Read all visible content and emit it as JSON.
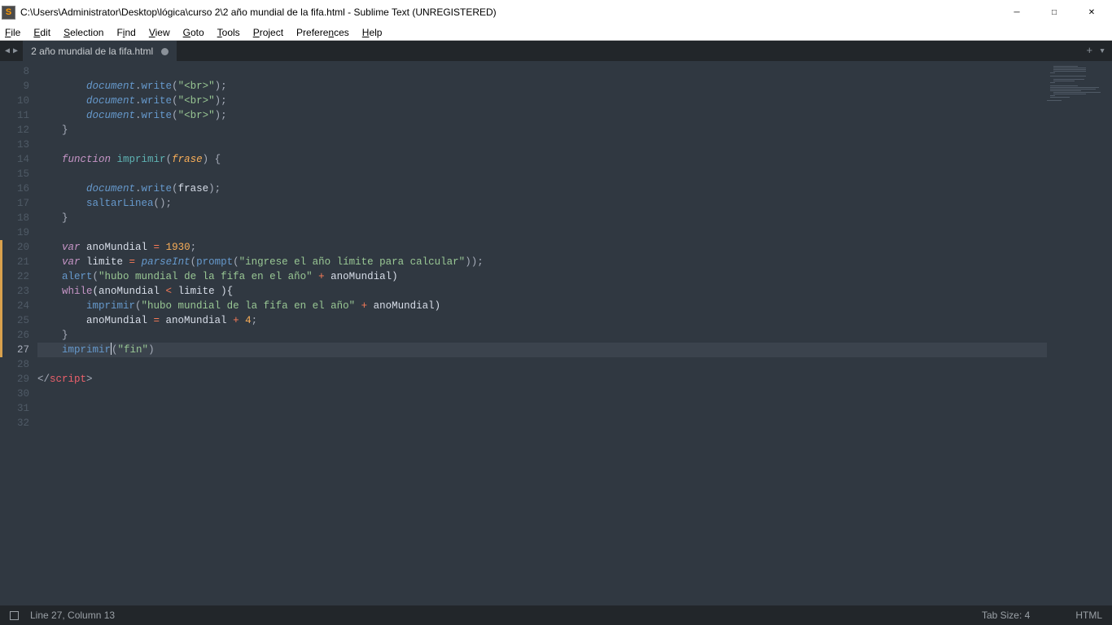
{
  "window": {
    "title": "C:\\Users\\Administrator\\Desktop\\lógica\\curso 2\\2 año mundial de la fifa.html - Sublime Text (UNREGISTERED)"
  },
  "menu": {
    "file": "File",
    "edit": "Edit",
    "selection": "Selection",
    "find": "Find",
    "view": "View",
    "goto": "Goto",
    "tools": "Tools",
    "project": "Project",
    "preferences": "Preferences",
    "help": "Help"
  },
  "tab": {
    "name": "2 año mundial de la fifa.html"
  },
  "gutter": {
    "start": 8,
    "end": 32,
    "active": 27,
    "modified": [
      20,
      21,
      22,
      23,
      24,
      25,
      26,
      27
    ]
  },
  "code": {
    "l8": "",
    "l9a": "document",
    "l9b": ".",
    "l9c": "write",
    "l9d": "(",
    "l9e": "\"<br>\"",
    "l9f": ");",
    "l10a": "document",
    "l10b": ".",
    "l10c": "write",
    "l10d": "(",
    "l10e": "\"<br>\"",
    "l10f": ");",
    "l11a": "document",
    "l11b": ".",
    "l11c": "write",
    "l11d": "(",
    "l11e": "\"<br>\"",
    "l11f": ");",
    "l12": "}",
    "l14a": "function",
    "l14b": " ",
    "l14c": "imprimir",
    "l14d": "(",
    "l14e": "frase",
    "l14f": ")",
    "l14g": " {",
    "l16a": "document",
    "l16b": ".",
    "l16c": "write",
    "l16d": "(",
    "l16e": "frase",
    "l16f": ");",
    "l17a": "saltarLinea",
    "l17b": "();",
    "l18": "}",
    "l20a": "var",
    "l20b": " anoMundial ",
    "l20c": "=",
    "l20d": " ",
    "l20e": "1930",
    "l20f": ";",
    "l21a": "var",
    "l21b": " limite ",
    "l21c": "=",
    "l21d": " ",
    "l21e": "parseInt",
    "l21f": "(",
    "l21g": "prompt",
    "l21h": "(",
    "l21i": "\"ingrese el año límite para calcular\"",
    "l21j": "));",
    "l22a": "alert",
    "l22b": "(",
    "l22c": "\"hubo mundial de la fifa en el año\"",
    "l22d": " ",
    "l22e": "+",
    "l22f": " anoMundial)",
    "l23a": "while",
    "l23b": "(anoMundial ",
    "l23c": "<",
    "l23d": " limite ){",
    "l24a": "imprimir",
    "l24b": "(",
    "l24c": "\"hubo mundial de la fifa en el año\"",
    "l24d": " ",
    "l24e": "+",
    "l24f": " anoMundial)",
    "l25a": "anoMundial ",
    "l25b": "=",
    "l25c": " anoMundial ",
    "l25d": "+",
    "l25e": " ",
    "l25f": "4",
    "l25g": ";",
    "l26": "}",
    "l27a": "imprimir",
    "l27b": "(",
    "l27c": "\"fin\"",
    "l27d": ")",
    "l29a": "</",
    "l29b": "script",
    "l29c": ">"
  },
  "status": {
    "pos": "Line 27, Column 13",
    "tabsize": "Tab Size: 4",
    "lang": "HTML"
  }
}
